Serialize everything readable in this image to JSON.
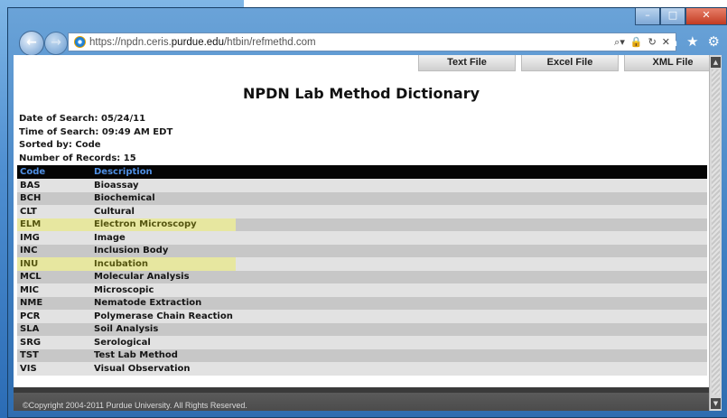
{
  "browser": {
    "url_prefix": "https://npdn.ceris.",
    "url_domain": "purdue.edu",
    "url_path": "/htbin/refmethd.com",
    "address_tools": [
      "⌕▾",
      "🔒",
      "↻",
      "✕"
    ],
    "right_tools": [
      "⌂",
      "★",
      "⚙"
    ],
    "window_controls": {
      "minimize": "–",
      "maximize": "□",
      "close": "✕"
    }
  },
  "export": {
    "text_file": "Text File",
    "excel_file": "Excel File",
    "xml_file": "XML File"
  },
  "page": {
    "title": "NPDN Lab Method Dictionary",
    "date_of_search": "Date of Search: 05/24/11",
    "time_of_search": "Time of Search: 09:49 AM EDT",
    "sorted_by": "Sorted by: Code",
    "record_count": "Number of Records: 15"
  },
  "table": {
    "headers": {
      "code": "Code",
      "description": "Description"
    },
    "rows": [
      {
        "code": "BAS",
        "description": "Bioassay"
      },
      {
        "code": "BCH",
        "description": "Biochemical"
      },
      {
        "code": "CLT",
        "description": "Cultural"
      },
      {
        "code": "ELM",
        "description": "Electron Microscopy"
      },
      {
        "code": "IMG",
        "description": "Image"
      },
      {
        "code": "INC",
        "description": "Inclusion Body"
      },
      {
        "code": "INU",
        "description": "Incubation"
      },
      {
        "code": "MCL",
        "description": "Molecular Analysis"
      },
      {
        "code": "MIC",
        "description": "Microscopic"
      },
      {
        "code": "NME",
        "description": "Nematode Extraction"
      },
      {
        "code": "PCR",
        "description": "Polymerase Chain Reaction"
      },
      {
        "code": "SLA",
        "description": "Soil Analysis"
      },
      {
        "code": "SRG",
        "description": "Serological"
      },
      {
        "code": "TST",
        "description": "Test Lab Method"
      },
      {
        "code": "VIS",
        "description": "Visual Observation"
      }
    ]
  },
  "footer": {
    "copyright": "©Copyright 2004-2011 Purdue University. All Rights Reserved."
  },
  "colors": {
    "header_bg": "#050505",
    "header_text": "#4f8fe3",
    "row_light": "#e2e2e2",
    "row_dark": "#c7c7c7",
    "highlight": "#e7e7a0"
  },
  "icons": [
    "back-arrow-icon",
    "forward-arrow-icon",
    "ie-logo-icon",
    "search-icon",
    "lock-icon",
    "refresh-icon",
    "stop-icon",
    "home-icon",
    "favorites-star-icon",
    "settings-gear-icon"
  ]
}
